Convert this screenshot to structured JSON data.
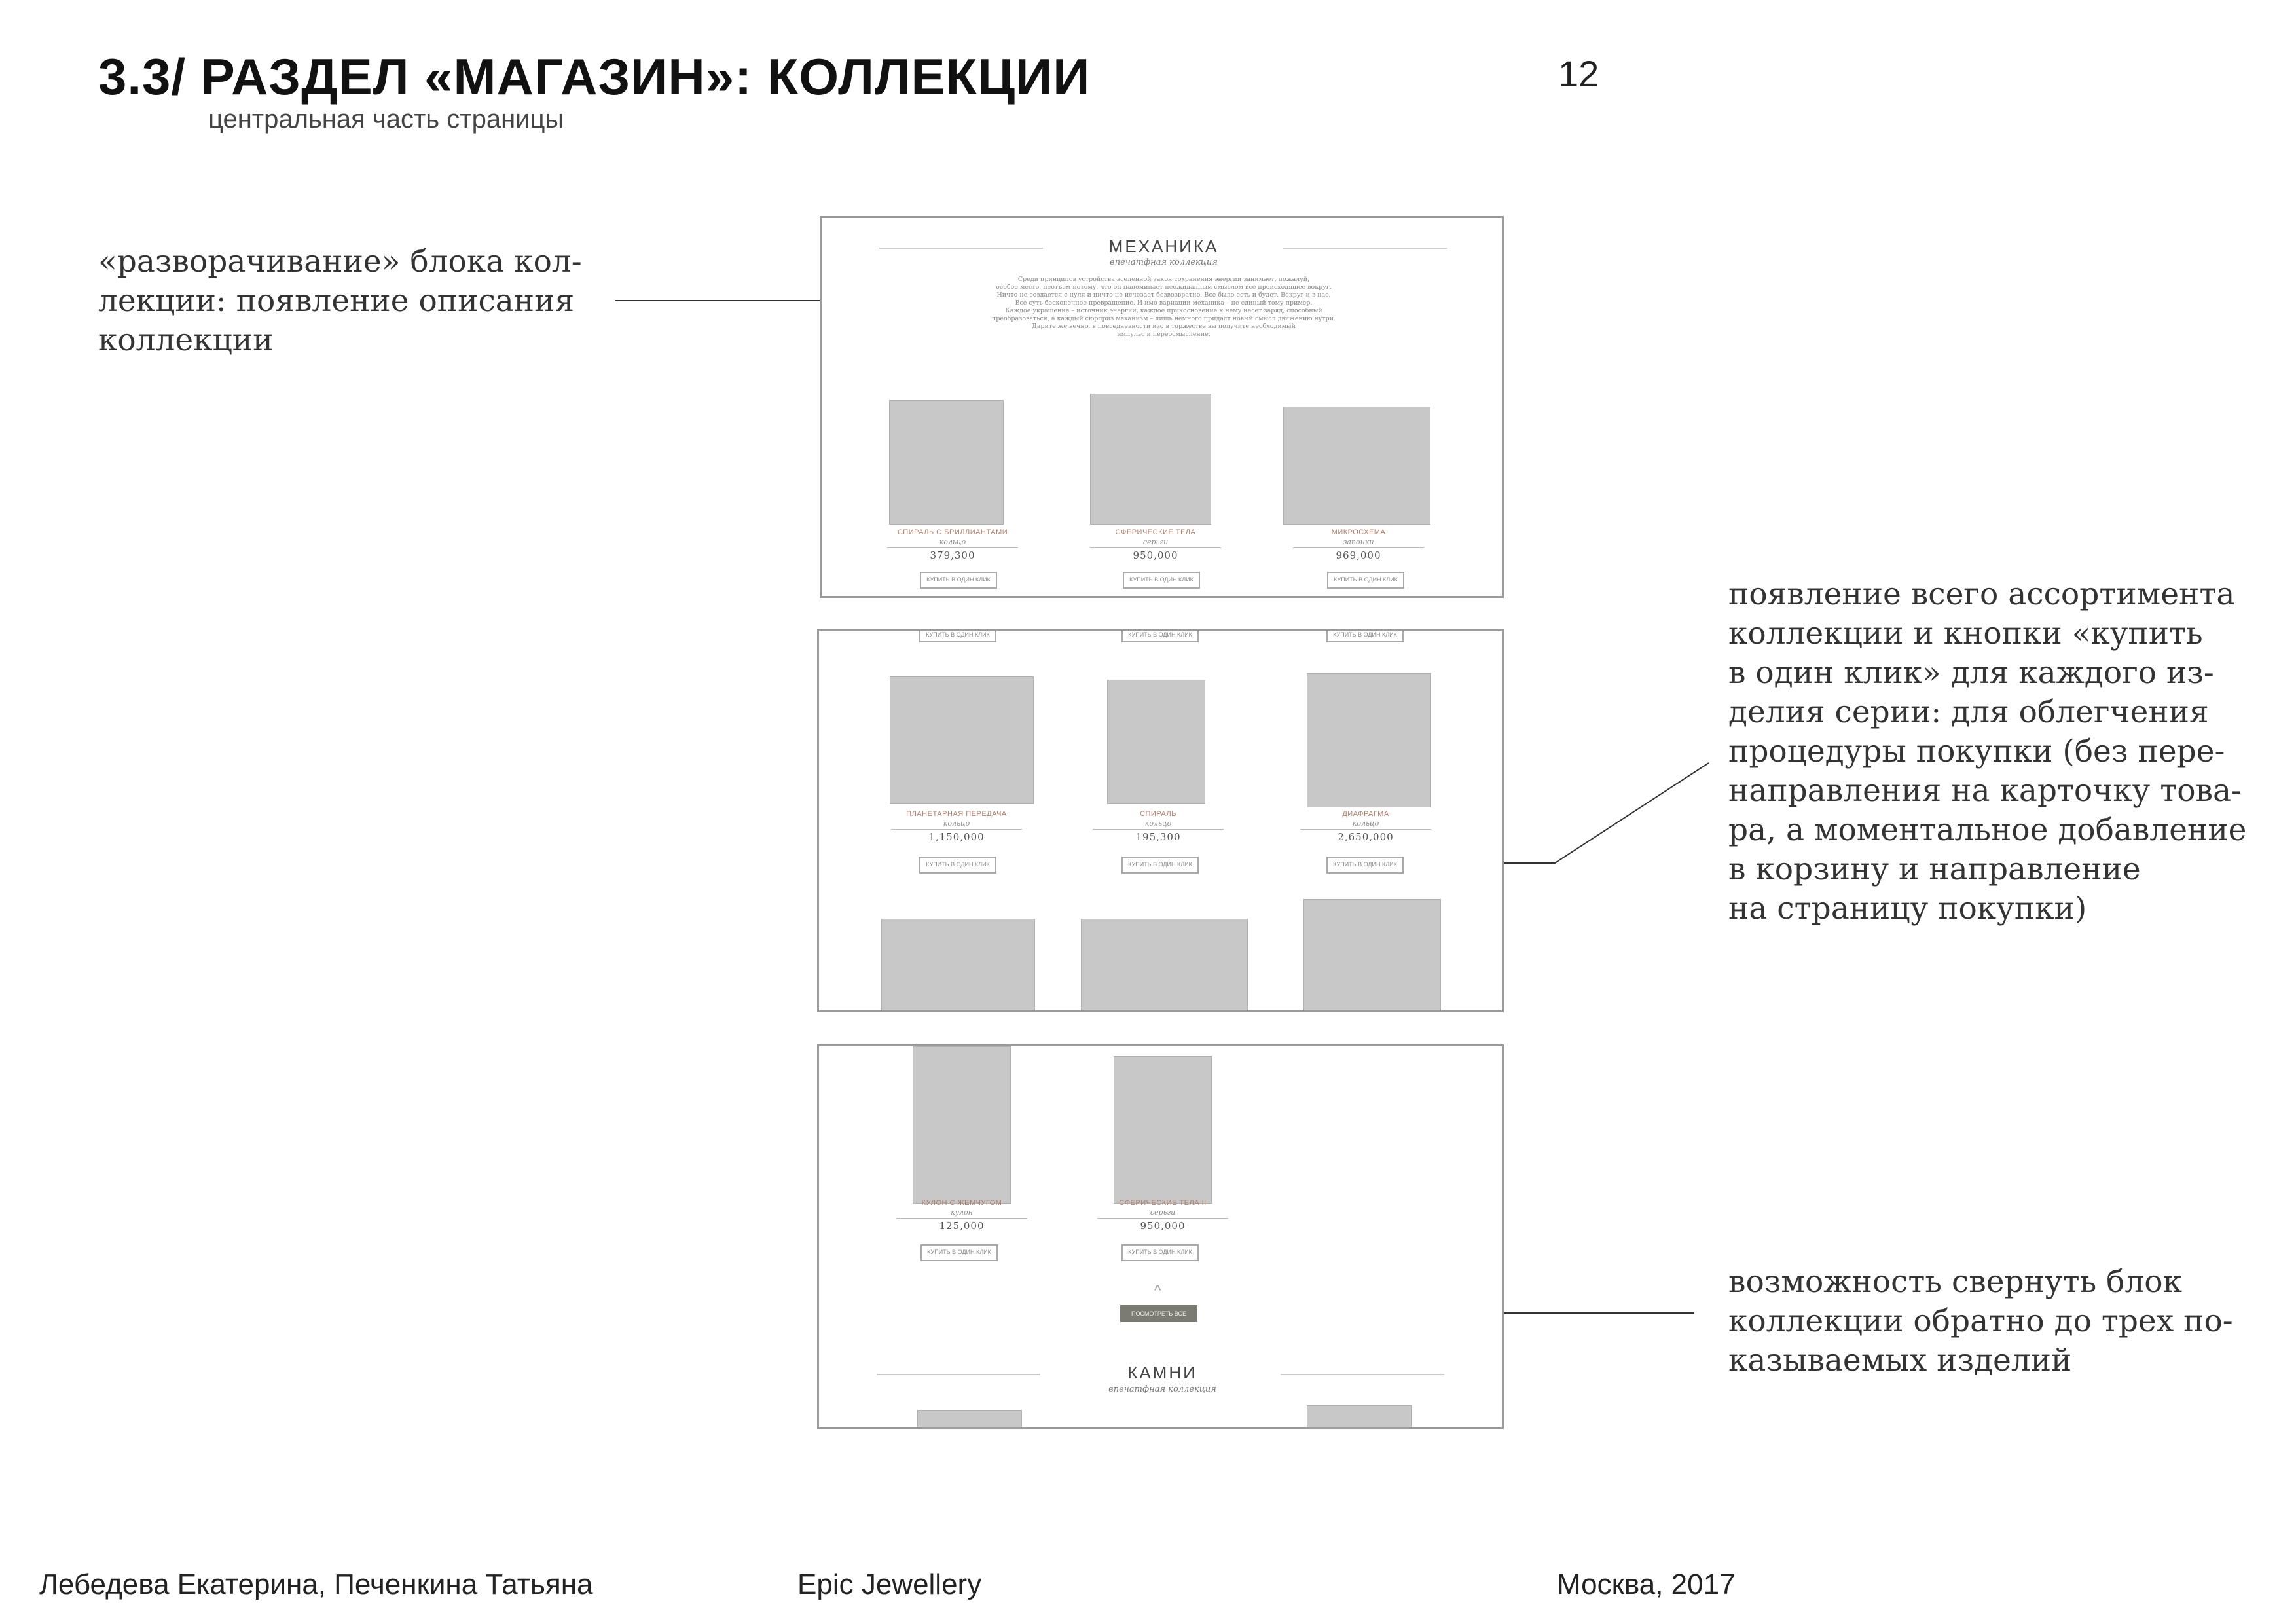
{
  "header": {
    "title": "3.3/ РАЗДЕЛ «МАГАЗИН»: КОЛЛЕКЦИИ",
    "subtitle": "центральная часть страницы",
    "page_number": "12"
  },
  "annotations": {
    "expand": [
      "«разворачивание» блока кол-",
      "лекции: появление описания",
      "коллекции"
    ],
    "assortment": [
      "появление всего ассортимента",
      "коллекции и кнопки «купить",
      "в один клик» для каждого из-",
      "делия серии: для облегчения",
      "процедуры покупки (без пере-",
      "направления на карточку това-",
      "ра, а моментальное добавление",
      "в корзину и направление",
      "на страницу покупки)"
    ],
    "collapse": [
      "возможность свернуть блок",
      "коллекции обратно до трех по-",
      "казываемых изделий"
    ]
  },
  "collection_block": {
    "title": "МЕХАНИКА",
    "subtitle": "впечатфная коллекция",
    "description": [
      "Среди принципов устройства вселенной закон сохранения энергии занимает, пожалуй,",
      "особое место, неотъем потому, что он напоминает неожиданным смыслом все происходящее вокруг.",
      "Ничто не создается с нуля и ничто не исчезает безвозвратно. Все было есть и будет. Вокруг и в нас.",
      "Все суть бесконечное превращение. И имо вариации механика – не единый тому пример.",
      "Каждое украшение – источник энергии, каждое прикосновение к нему несет заряд, способный",
      "преобразоваться, а каждый сюрприз механизм – лишь немного придаст новый смысл движению нутри.",
      "Дарите же вечно, в повседневности изо в торжестве вы получите необходимый",
      "импульс и переосмысление."
    ],
    "buy_label": "КУПИТЬ В ОДИН КЛИК"
  },
  "frame1_products": [
    {
      "name": "СПИРАЛЬ С БРИЛЛИАНТАМИ",
      "category": "кольцо",
      "price": "379,300"
    },
    {
      "name": "СФЕРИЧЕСКИЕ ТЕЛА",
      "category": "серьги",
      "price": "950,000"
    },
    {
      "name": "МИКРОСХЕМА",
      "category": "запонки",
      "price": "969,000"
    }
  ],
  "frame2_products": [
    {
      "name": "ПЛАНЕТАРНАЯ ПЕРЕДАЧА",
      "category": "кольцо",
      "price": "1,150,000"
    },
    {
      "name": "СПИРАЛЬ",
      "category": "кольцо",
      "price": "195,300"
    },
    {
      "name": "ДИАФРАГМА",
      "category": "кольцо",
      "price": "2,650,000"
    }
  ],
  "frame3_products": [
    {
      "name": "КУЛОН С ЖЕМЧУГОМ",
      "category": "кулон",
      "price": "125,000"
    },
    {
      "name": "СФЕРИЧЕСКИЕ ТЕЛА II",
      "category": "серьги",
      "price": "950,000"
    }
  ],
  "collapse_button": "ПОСМОТРЕТЬ ВСЕ",
  "next_collection": {
    "title": "КАМНИ",
    "subtitle": "впечатфная коллекция"
  },
  "footer": {
    "authors": "Лебедева Екатерина, Печенкина Татьяна",
    "project": "Epic Jewellery",
    "place_year": "Москва, 2017"
  },
  "colors": {
    "placeholder": "#C8C8C8",
    "frame_border": "#9a9a9a",
    "collapse_button_bg": "#7b7b73"
  }
}
